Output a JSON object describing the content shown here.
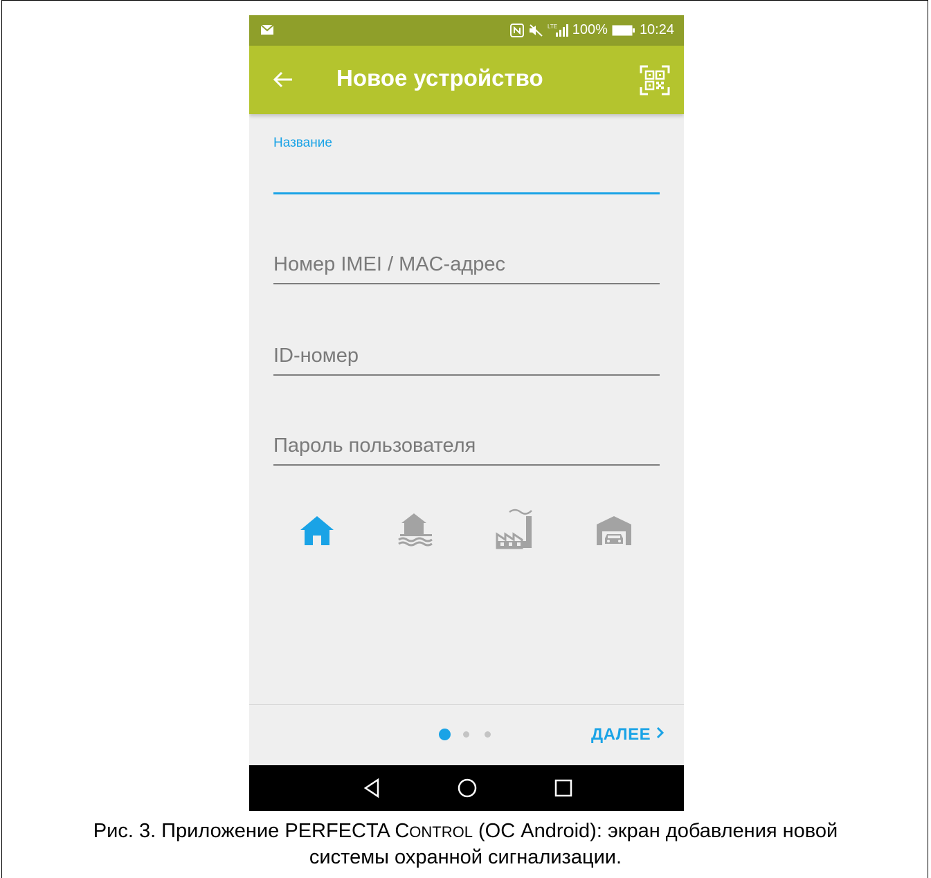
{
  "status_bar": {
    "battery": "100%",
    "time": "10:24",
    "network": "LTE",
    "icons": [
      "mail-icon",
      "nfc-icon",
      "mute-icon",
      "signal-icon",
      "battery-icon"
    ]
  },
  "app_bar": {
    "title": "Новое устройство",
    "icons": [
      "back-arrow-icon",
      "qr-code-icon"
    ]
  },
  "form": {
    "name_label": "Название",
    "imei_placeholder": "Номер IMEI / MAC-адрес",
    "id_placeholder": "ID-номер",
    "password_placeholder": "Пароль пользователя"
  },
  "object_types": [
    {
      "icon": "home-icon",
      "selected": true
    },
    {
      "icon": "house-by-water-icon",
      "selected": false
    },
    {
      "icon": "factory-icon",
      "selected": false
    },
    {
      "icon": "garage-icon",
      "selected": false
    }
  ],
  "pager": {
    "pages": 3,
    "current": 1
  },
  "next_button": "ДАЛЕЕ",
  "nav_icons": [
    "nav-back-icon",
    "nav-home-icon",
    "nav-recents-icon"
  ],
  "colors": {
    "accent": "#1aa3e6",
    "appbar": "#b4c42e",
    "statusbar": "#8f9f2a"
  },
  "caption": {
    "part1": "Рис. 3. Приложение PERFECTA C",
    "small_caps": "ONTROL",
    "part2": " (ОС Android): экран добавления новой",
    "line2": "системы охранной сигнализации."
  }
}
